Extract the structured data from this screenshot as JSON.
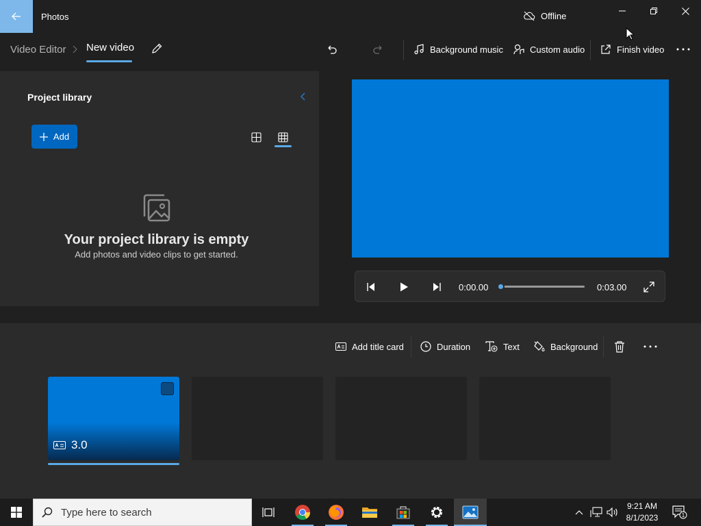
{
  "titlebar": {
    "app_title": "Photos",
    "status": "Offline"
  },
  "header": {
    "breadcrumb_root": "Video Editor",
    "project_title": "New video"
  },
  "commands": {
    "background_music": "Background music",
    "custom_audio": "Custom audio",
    "finish_video": "Finish video"
  },
  "library": {
    "title": "Project library",
    "add_label": "Add",
    "empty_title": "Your project library is empty",
    "empty_subtitle": "Add photos and video clips to get started."
  },
  "player": {
    "current_time": "0:00.00",
    "end_time": "0:03.00",
    "progress": 0
  },
  "storyboard": {
    "add_title_card": "Add title card",
    "duration": "Duration",
    "text": "Text",
    "background": "Background",
    "cards": [
      {
        "duration": "3.0",
        "selected": true,
        "color": "#0078d7"
      }
    ]
  },
  "taskbar": {
    "search_placeholder": "Type here to search",
    "time": "9:21 AM",
    "date": "8/1/2023",
    "notification_count": "1"
  },
  "colors": {
    "accent": "#0078d7",
    "accent_light": "#5aa9e6",
    "background": "#202020",
    "panel": "#2b2b2b"
  }
}
